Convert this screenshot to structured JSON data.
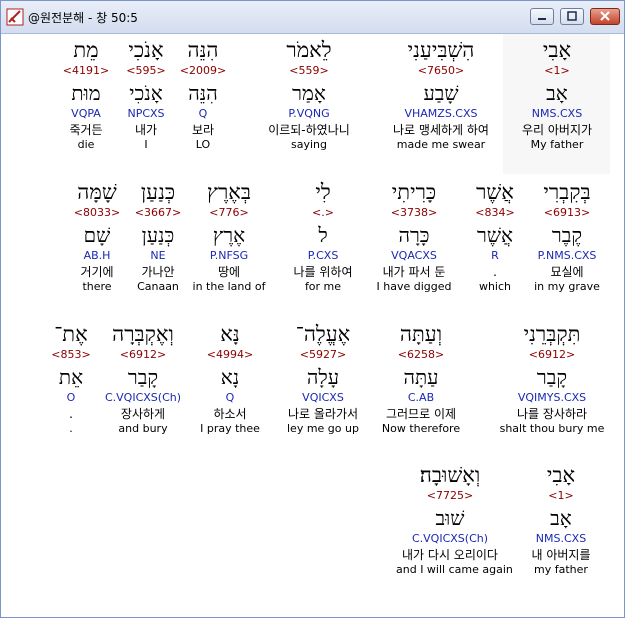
{
  "window": {
    "title": "@원전분해 - 창 50:5"
  },
  "rows": [
    [
      {
        "heb": "אָבִי",
        "num": "<1>",
        "root": "אָב",
        "morph": "NMS.CXS",
        "kor": "우리 아버지가",
        "eng": "My father"
      },
      {
        "heb": "הִשְׁבִּיעַנִי",
        "num": "<7650>",
        "root": "שָׁבַע",
        "morph": "VHAMZS.CXS",
        "kor": "나로 맹세하게 하여",
        "eng": "made me swear"
      },
      {
        "heb": "לֵאמֹר",
        "num": "<559>",
        "root": "אָמַר",
        "morph": "P.VQNG",
        "kor": "이르되-하였나니",
        "eng": "saying"
      },
      {
        "heb": "הִנֵּה",
        "num": "<2009>",
        "root": "הִנֵּה",
        "morph": "Q",
        "kor": "보라",
        "eng": "LO"
      },
      {
        "heb": "אָנֹכִי",
        "num": "<595>",
        "root": "אָנֹכִי",
        "morph": "NPCXS",
        "kor": "내가",
        "eng": "I"
      },
      {
        "heb": "מֵת",
        "num": "<4191>",
        "root": "מוּת",
        "morph": "VQPA",
        "kor": "죽거든",
        "eng": "die"
      }
    ],
    [
      {
        "heb": "בְּקִבְרִי",
        "num": "<6913>",
        "root": "קֶבֶר",
        "morph": "P.NMS.CXS",
        "kor": "묘실에",
        "eng": "in my grave"
      },
      {
        "heb": "אֲשֶׁר",
        "num": "<834>",
        "root": "אֲשֶׁר",
        "morph": "R",
        "kor": ".",
        "eng": "which"
      },
      {
        "heb": "כָּרִיתִי",
        "num": "<3738>",
        "root": "כָּרָה",
        "morph": "VQACXS",
        "kor": "내가 파서 둔",
        "eng": "I have digged"
      },
      {
        "heb": "לִי",
        "num": "<.>",
        "root": "ל",
        "morph": "P.CXS",
        "kor": "나를 위하여",
        "eng": "for me"
      },
      {
        "heb": "בְּאֶרֶץ",
        "num": "<776>",
        "root": "אֶרֶץ",
        "morph": "P.NFSG",
        "kor": "땅에",
        "eng": "in the land of"
      },
      {
        "heb": "כְּנַעַן",
        "num": "<3667>",
        "root": "כְּנַעַן",
        "morph": "NE",
        "kor": "가나안",
        "eng": "Canaan"
      },
      {
        "heb": "שָׁמָּה",
        "num": "<8033>",
        "root": "שָׁם",
        "morph": "AB.H",
        "kor": "거기에",
        "eng": "there"
      }
    ],
    [
      {
        "heb": "תִּקְבְּרֵנִי",
        "num": "<6912>",
        "root": "קָבַר",
        "morph": "VQIMYS.CXS",
        "kor": "나를 장사하라",
        "eng": "shalt thou bury me"
      },
      {
        "heb": "וְעַתָּה",
        "num": "<6258>",
        "root": "עַתָּה",
        "morph": "C.AB",
        "kor": "그러므로 이제",
        "eng": "Now therefore"
      },
      {
        "heb": "אֶעֱלֶה־",
        "num": "<5927>",
        "root": "עָלָה",
        "morph": "VQICXS",
        "kor": "나로 올라가서",
        "eng": "ley me go up"
      },
      {
        "heb": "נָּא",
        "num": "<4994>",
        "root": "נָא",
        "morph": "Q",
        "kor": "하소서",
        "eng": "I pray thee"
      },
      {
        "heb": "וְאֶקְבְּרָה",
        "num": "<6912>",
        "root": "קָבַר",
        "morph": "C.VQICXS(Ch)",
        "kor": "장사하게",
        "eng": "and bury"
      },
      {
        "heb": "אֶת־",
        "num": "<853>",
        "root": "אֵת",
        "morph": "O",
        "kor": ".",
        "eng": "."
      }
    ],
    [
      {
        "heb": "אָבִי",
        "num": "<1>",
        "root": "אָב",
        "morph": "NMS.CXS",
        "kor": "내 아버지를",
        "eng": "my father"
      },
      {
        "heb": "וְאָשׁוּבָה׃",
        "num": "<7725>",
        "root": "שׁוּב",
        "morph": "C.VQICXS(Ch)",
        "kor": "내가 다시 오리이다",
        "eng": "and I will came again"
      }
    ]
  ]
}
